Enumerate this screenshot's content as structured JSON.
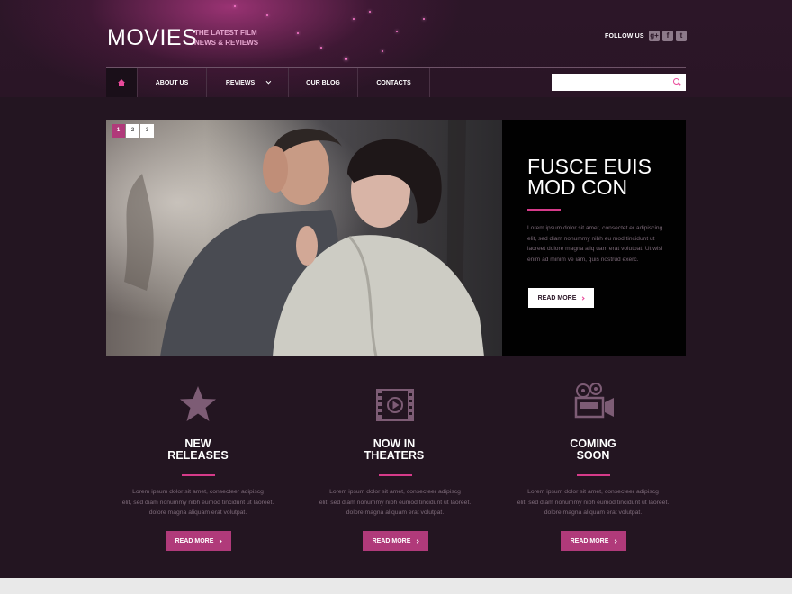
{
  "header": {
    "logo": "MOVIES",
    "tagline_line1": "THE LATEST FILM",
    "tagline_line2": "NEWS & REVIEWS",
    "follow_label": "FOLLOW US",
    "social": [
      {
        "icon": "google-plus-icon",
        "glyph": "g+"
      },
      {
        "icon": "facebook-icon",
        "glyph": "f"
      },
      {
        "icon": "twitter-icon",
        "glyph": "t"
      }
    ]
  },
  "nav": {
    "home_icon": "home-icon",
    "items": [
      {
        "label": "ABOUT US"
      },
      {
        "label": "REVIEWS",
        "has_dropdown": true
      },
      {
        "label": "OUR BLOG"
      },
      {
        "label": "CONTACTS"
      }
    ],
    "search": {
      "value": "",
      "placeholder": "",
      "icon": "search-icon"
    }
  },
  "hero": {
    "pager": [
      "1",
      "2",
      "3"
    ],
    "active_page": "1",
    "title_line1": "FUSCE EUIS",
    "title_line2": "MOD CON",
    "text": "Lorem ipsum dolor sit amet, consectet er adipiscing elit, sed diam nonummy nibh eu mod tincidunt ut laoreet dolore magna aliq uam erat volutpat. Ut wisi enim ad minim ve iam, quis nostrud exerc.",
    "button": "READ MORE"
  },
  "features": [
    {
      "icon": "star-icon",
      "title_line1": "NEW",
      "title_line2": "RELEASES",
      "text_line1": "Lorem ipsum dolor sit amet, consecteer adipiscg",
      "text_line2": "elit, sed diam nonummy nibh eumod tincidunt ut laoreet.",
      "text_line3": "dolore magna aliquam erat volutpat.",
      "button": "READ MORE"
    },
    {
      "icon": "film-play-icon",
      "title_line1": "NOW IN",
      "title_line2": "THEATERS",
      "text_line1": "Lorem ipsum dolor sit amet, consecteer adipiscg",
      "text_line2": "elit, sed diam nonummy nibh eumod tincidunt ut laoreet.",
      "text_line3": "dolore magna aliquam erat volutpat.",
      "button": "READ MORE"
    },
    {
      "icon": "movie-camera-icon",
      "title_line1": "COMING",
      "title_line2": "SOON",
      "text_line1": "Lorem ipsum dolor sit amet, consecteer adipiscg",
      "text_line2": "elit, sed diam nonummy nibh eumod tincidunt ut laoreet.",
      "text_line3": "dolore magna aliquam erat volutpat.",
      "button": "READ MORE"
    }
  ],
  "colors": {
    "accent": "#d63b8a",
    "background": "#231521",
    "button_pink": "#b03a7a"
  }
}
